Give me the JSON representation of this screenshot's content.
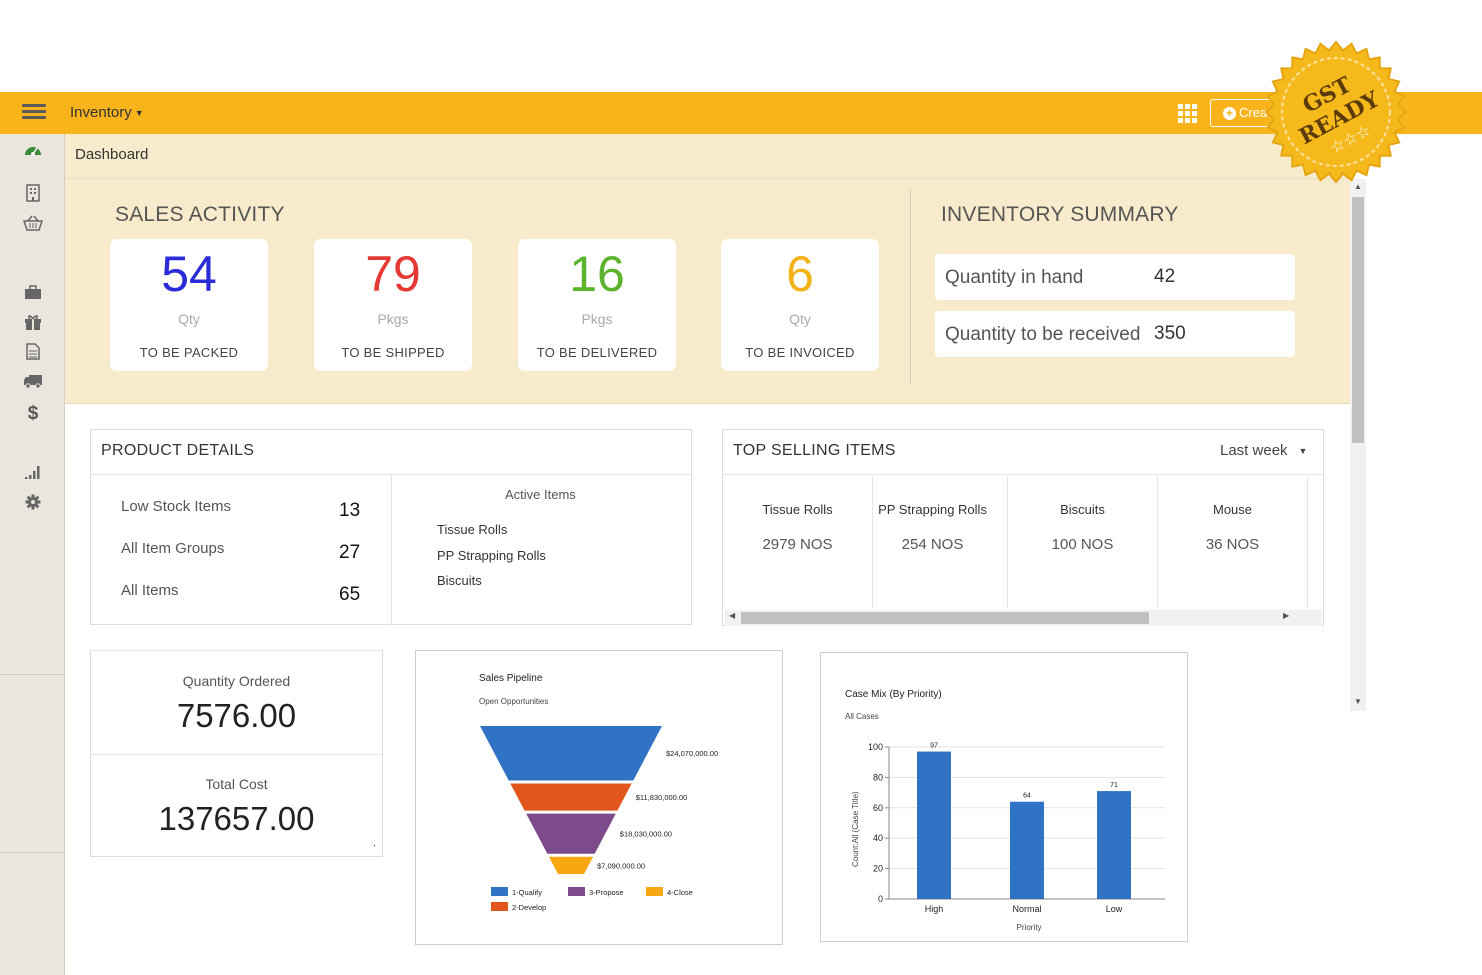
{
  "topbar": {
    "module_label": "Inventory",
    "create_label": "Crea"
  },
  "sidebar": {
    "icons": [
      "dashboard-icon",
      "building-icon",
      "basket-icon",
      "bag-icon",
      "gift-icon",
      "document-icon",
      "truck-icon",
      "dollar-icon",
      "reports-icon",
      "settings-icon"
    ]
  },
  "breadcrumb": "Dashboard",
  "sales_activity": {
    "title": "SALES ACTIVITY",
    "cards": [
      {
        "value": "54",
        "unit": "Qty",
        "label": "TO BE PACKED",
        "color": "#2b2bd8"
      },
      {
        "value": "79",
        "unit": "Pkgs",
        "label": "TO BE SHIPPED",
        "color": "#e53935"
      },
      {
        "value": "16",
        "unit": "Pkgs",
        "label": "TO BE DELIVERED",
        "color": "#5cb32e"
      },
      {
        "value": "6",
        "unit": "Qty",
        "label": "TO BE INVOICED",
        "color": "#f2b218"
      }
    ]
  },
  "inventory_summary": {
    "title": "INVENTORY SUMMARY",
    "rows": [
      {
        "label": "Quantity in hand",
        "value": "42"
      },
      {
        "label": "Quantity to be received",
        "value": "350"
      }
    ]
  },
  "product_details": {
    "title": "PRODUCT DETAILS",
    "rows": [
      {
        "label": "Low Stock Items",
        "value": "13"
      },
      {
        "label": "All Item Groups",
        "value": "27"
      },
      {
        "label": "All Items",
        "value": "65"
      }
    ],
    "active_title": "Active Items",
    "active_items": [
      "Tissue Rolls",
      "PP Strapping Rolls",
      "Biscuits"
    ]
  },
  "top_selling": {
    "title": "TOP SELLING ITEMS",
    "period": "Last week",
    "items": [
      {
        "name": "Tissue Rolls",
        "qty": "2979 NOS"
      },
      {
        "name": "PP Strapping Rolls",
        "qty": "254 NOS"
      },
      {
        "name": "Biscuits",
        "qty": "100 NOS"
      },
      {
        "name": "Mouse",
        "qty": "36 NOS"
      }
    ]
  },
  "kpis": {
    "ordered_label": "Quantity Ordered",
    "ordered_value": "7576.00",
    "cost_label": "Total Cost",
    "cost_value": "137657.00",
    "dot": "."
  },
  "chart_data": [
    {
      "type": "funnel",
      "title": "Sales Pipeline",
      "subtitle": "Open Opportunities",
      "stages": [
        {
          "name": "1-Qualify",
          "value": 24070000,
          "label": "$24,070,000.00",
          "color": "#3072c4"
        },
        {
          "name": "2-Develop",
          "value": 11830000,
          "label": "$11,830,000.00",
          "color": "#e1561d"
        },
        {
          "name": "3-Propose",
          "value": 18030000,
          "label": "$18,030,000.00",
          "color": "#7d4a8c"
        },
        {
          "name": "4-Close",
          "value": 7090000,
          "label": "$7,090,000.00",
          "color": "#f7a712"
        }
      ],
      "legend": [
        "1-Qualify",
        "3-Propose",
        "4-Close",
        "2-Develop"
      ]
    },
    {
      "type": "bar",
      "title": "Case Mix (By Priority)",
      "subtitle": "All Cases",
      "categories": [
        "High",
        "Normal",
        "Low"
      ],
      "values": [
        97,
        64,
        71
      ],
      "xlabel": "Priority",
      "ylabel": "Count:All (Case Title)",
      "ylim": [
        0,
        100
      ],
      "yticks": [
        0,
        20,
        40,
        60,
        80,
        100
      ],
      "grid": true,
      "color": "#3072c4"
    }
  ],
  "badge": {
    "line1": "GST",
    "line2": "READY",
    "color": "#f6b91c"
  }
}
